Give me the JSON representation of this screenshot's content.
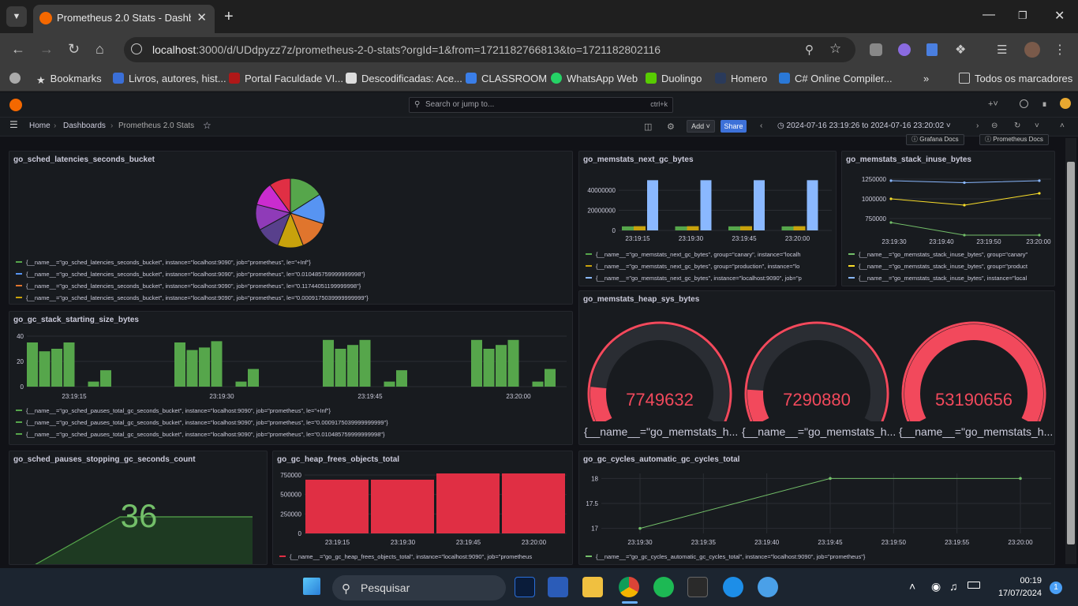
{
  "browser": {
    "tab_title": "Prometheus 2.0 Stats - Dashboa",
    "url_host": "localhost",
    "url_rest": ":3000/d/UDdpyzz7z/prometheus-2-0-stats?orgId=1&from=1721182766813&to=1721182802116"
  },
  "bookmarks": [
    "Bookmarks",
    "Livros, autores, hist...",
    "Portal Faculdade VI...",
    "Descodificadas: Ace...",
    "CLASSROOM",
    "WhatsApp Web",
    "Duolingo",
    "Homero",
    "C# Online Compiler...",
    "Todos os marcadores"
  ],
  "grafana": {
    "search_placeholder": "Search or jump to...",
    "search_kbd": "ctrl+k",
    "breadcrumb": [
      "Home",
      "Dashboards",
      "Prometheus 2.0 Stats"
    ],
    "add_label": "Add",
    "share_label": "Share",
    "time_range": "2024-07-16 23:19:26 to 2024-07-16 23:20:02",
    "links": [
      "Grafana Docs",
      "Prometheus Docs"
    ]
  },
  "panels": {
    "p1": {
      "title": "go_sched_latencies_seconds_bucket",
      "legend": [
        "{__name__=\"go_sched_latencies_seconds_bucket\", instance=\"localhost:9090\", job=\"prometheus\", le=\"+Inf\"}",
        "{__name__=\"go_sched_latencies_seconds_bucket\", instance=\"localhost:9090\", job=\"prometheus\", le=\"0.010485759999999998\"}",
        "{__name__=\"go_sched_latencies_seconds_bucket\", instance=\"localhost:9090\", job=\"prometheus\", le=\"0.11744051199999998\"}",
        "{__name__=\"go_sched_latencies_seconds_bucket\", instance=\"localhost:9090\", job=\"prometheus\", le=\"0.0009175039999999999\"}"
      ]
    },
    "p2": {
      "title": "go_memstats_next_gc_bytes",
      "legend": [
        "{__name__=\"go_memstats_next_gc_bytes\", group=\"canary\", instance=\"localh",
        "{__name__=\"go_memstats_next_gc_bytes\", group=\"production\", instance=\"lo",
        "{__name__=\"go_memstats_next_gc_bytes\", instance=\"localhost:9090\", job=\"p"
      ]
    },
    "p3": {
      "title": "go_memstats_stack_inuse_bytes",
      "legend": [
        "{__name__=\"go_memstats_stack_inuse_bytes\", group=\"canary\"",
        "{__name__=\"go_memstats_stack_inuse_bytes\", group=\"product",
        "{__name__=\"go_memstats_stack_inuse_bytes\", instance=\"local"
      ]
    },
    "p4": {
      "title": "go_gc_stack_starting_size_bytes",
      "legend": [
        "{__name__=\"go_sched_pauses_total_gc_seconds_bucket\", instance=\"localhost:9090\", job=\"prometheus\", le=\"+Inf\"}",
        "{__name__=\"go_sched_pauses_total_gc_seconds_bucket\", instance=\"localhost:9090\", job=\"prometheus\", le=\"0.0009175039999999999\"}",
        "{__name__=\"go_sched_pauses_total_gc_seconds_bucket\", instance=\"localhost:9090\", job=\"prometheus\", le=\"0.010485759999999998\"}"
      ]
    },
    "p5": {
      "title": "go_memstats_heap_sys_bytes",
      "gauges": [
        {
          "value": "7749632",
          "label": "{__name__=\"go_memstats_h...",
          "fill": 0.14
        },
        {
          "value": "7290880",
          "label": "{__name__=\"go_memstats_h...",
          "fill": 0.13
        },
        {
          "value": "53190656",
          "label": "{__name__=\"go_memstats_h...",
          "fill": 1.0
        }
      ]
    },
    "p6": {
      "title": "go_sched_pauses_stopping_gc_seconds_count",
      "value": "36"
    },
    "p7": {
      "title": "go_gc_heap_frees_objects_total",
      "legend": [
        "{__name__=\"go_gc_heap_frees_objects_total\", instance=\"localhost:9090\", job=\"prometheus"
      ]
    },
    "p8": {
      "title": "go_gc_cycles_automatic_gc_cycles_total",
      "legend": [
        "{__name__=\"go_gc_cycles_automatic_gc_cycles_total\", instance=\"localhost:9090\", job=\"prometheus\"}"
      ]
    }
  },
  "taskbar": {
    "search": "Pesquisar",
    "time": "00:19",
    "date": "17/07/2024",
    "badge": "1"
  },
  "chart_data": [
    {
      "type": "pie",
      "title": "go_sched_latencies_seconds_bucket",
      "series": [
        {
          "values": [
            16,
            14,
            14,
            12,
            11,
            12,
            11,
            10
          ]
        }
      ],
      "colors": [
        "#56a64b",
        "#5794f2",
        "#e0752d",
        "#c8a20c",
        "#58408c",
        "#8f3bb8",
        "#ca2ccf",
        "#e02f44"
      ]
    },
    {
      "type": "bar",
      "title": "go_memstats_next_gc_bytes",
      "categories": [
        "23:19:15",
        "23:19:30",
        "23:19:45",
        "23:20:00"
      ],
      "ylim": [
        0,
        55000000
      ],
      "yticks": [
        0,
        20000000,
        40000000
      ],
      "series": [
        {
          "color": "#56a64b",
          "values": [
            4000000,
            4000000,
            4000000,
            4000000
          ]
        },
        {
          "color": "#c8a20c",
          "values": [
            4200000,
            4200000,
            4200000,
            4200000
          ]
        },
        {
          "color": "#8ab8ff",
          "values": [
            50000000,
            50000000,
            50000000,
            50000000
          ]
        }
      ]
    },
    {
      "type": "line",
      "title": "go_memstats_stack_inuse_bytes",
      "categories": [
        "23:19:30",
        "23:19:40",
        "23:19:50",
        "23:20:00"
      ],
      "ylim": [
        550000,
        1350000
      ],
      "yticks": [
        750000,
        1000000,
        1250000
      ],
      "series": [
        {
          "color": "#73bf69",
          "values": [
            700000,
            540000,
            540000
          ]
        },
        {
          "color": "#fade2a",
          "values": [
            1000000,
            920000,
            1070000
          ]
        },
        {
          "color": "#8ab8ff",
          "values": [
            1230000,
            1205000,
            1230000
          ]
        }
      ]
    },
    {
      "type": "bar",
      "title": "go_gc_stack_starting_size_bytes",
      "categories": [
        "23:19:15",
        "23:19:30",
        "23:19:45",
        "23:20:00"
      ],
      "ylim": [
        0,
        40
      ],
      "yticks": [
        0,
        20,
        40
      ],
      "groups": [
        [
          35,
          28,
          30,
          35,
          0,
          4,
          13
        ],
        [
          35,
          29,
          31,
          36,
          0,
          4,
          14
        ],
        [
          37,
          30,
          33,
          37,
          0,
          4,
          13
        ],
        [
          37,
          30,
          33,
          37,
          0,
          4,
          14
        ]
      ],
      "color": "#56a64b"
    },
    {
      "type": "bar",
      "title": "go_gc_heap_frees_objects_total",
      "categories": [
        "23:19:15",
        "23:19:30",
        "23:19:45",
        "23:20:00"
      ],
      "ylim": [
        0,
        750000
      ],
      "yticks": [
        0,
        250000,
        500000,
        750000
      ],
      "values": [
        690000,
        690000,
        760000,
        760000
      ],
      "color": "#e02f44"
    },
    {
      "type": "line",
      "title": "go_gc_cycles_automatic_gc_cycles_total",
      "categories": [
        "23:19:30",
        "23:19:35",
        "23:19:40",
        "23:19:45",
        "23:19:50",
        "23:19:55",
        "23:20:00"
      ],
      "ylim": [
        16.9,
        18.1
      ],
      "yticks": [
        17,
        17.5,
        18
      ],
      "x": [
        0,
        5,
        10,
        15,
        20,
        25,
        30
      ],
      "y": [
        17,
        null,
        null,
        18,
        null,
        null,
        18
      ],
      "color": "#73bf69"
    }
  ]
}
